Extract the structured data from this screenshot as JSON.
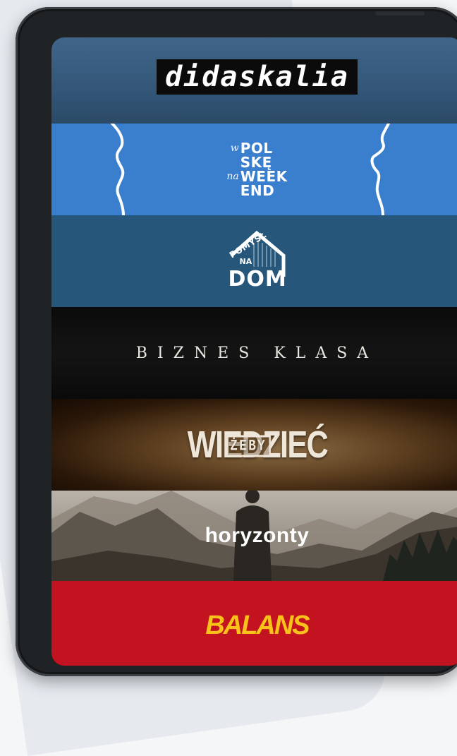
{
  "banners": [
    {
      "id": "didaskalia",
      "title": "didaskalia",
      "background": "#35587a"
    },
    {
      "id": "w-polske-na-weekend",
      "lines": [
        {
          "small": "w",
          "big": "POL"
        },
        {
          "small": "",
          "big": "SKĘ"
        },
        {
          "small": "na",
          "big": "WEEK"
        },
        {
          "small": "",
          "big": "END"
        }
      ],
      "background": "#3a7fce"
    },
    {
      "id": "pomysl-na-dom",
      "top": "POMYSŁ",
      "mid": "NA",
      "main": "DOM",
      "background": "#26577a"
    },
    {
      "id": "biznes-klasa",
      "title": "BIZNES KLASA",
      "background": "#0e0e0e"
    },
    {
      "id": "wiedziec",
      "title": "WIEDZIEĆ",
      "inner": "ŻEBY",
      "background": "#5c3e1f"
    },
    {
      "id": "horyzonty",
      "title": "horyzonty",
      "background": "#6f6a62"
    },
    {
      "id": "balans",
      "title": "BALANS",
      "background": "#c41320",
      "text_color": "#f7c21a"
    }
  ]
}
